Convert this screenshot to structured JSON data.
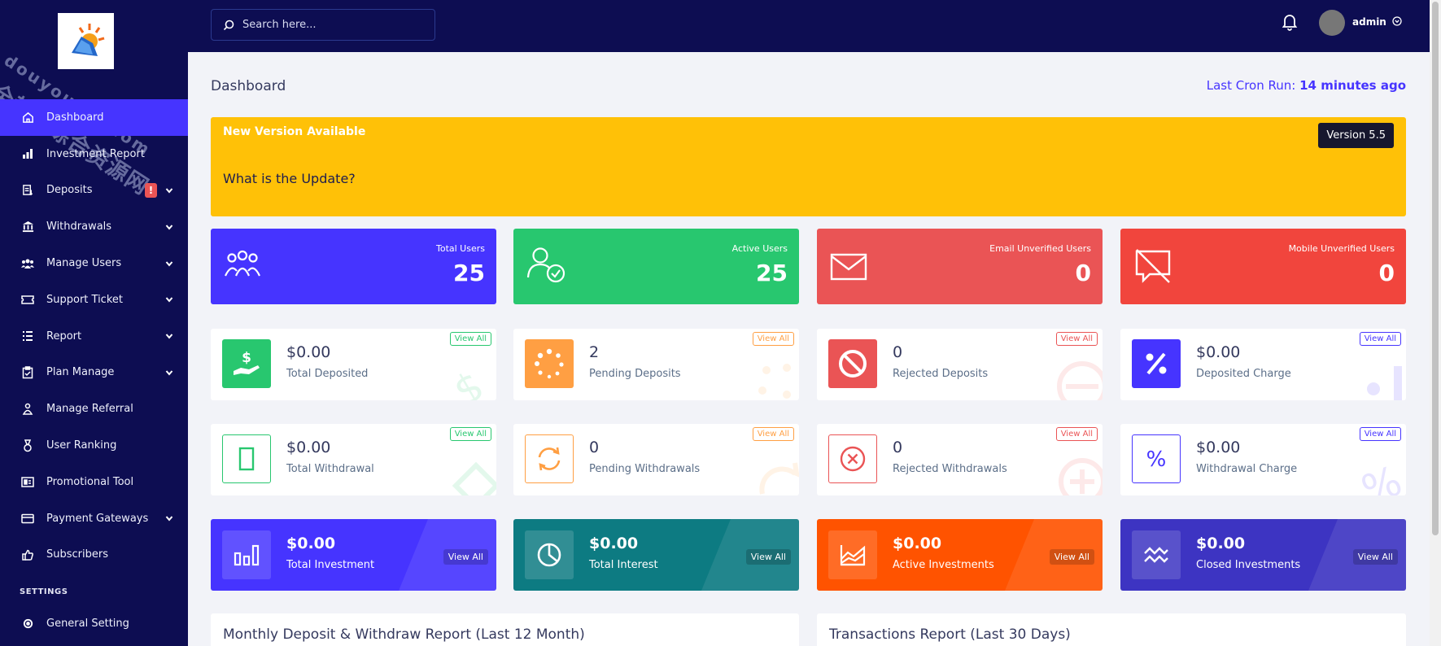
{
  "colors": {
    "sidebar": "#0d0d52",
    "accent": "#4634ff",
    "banner": "#ffc107",
    "success": "#28c76f",
    "danger": "#ea5455",
    "red": "#f1453d",
    "orange": "#ff9f43",
    "teal": "#0d7b82",
    "deep_orange": "#ff5300",
    "indigo": "#3d34c2"
  },
  "watermark": {
    "line1": "全都有综合资源网",
    "line2": "douyouvip.com"
  },
  "sidebar": {
    "items": [
      {
        "label": "Dashboard",
        "icon": "home-icon"
      },
      {
        "label": "Investment Report",
        "icon": "bar-chart-icon"
      },
      {
        "label": "Deposits",
        "icon": "deposit-icon",
        "badge": "!"
      },
      {
        "label": "Withdrawals",
        "icon": "bank-icon"
      },
      {
        "label": "Manage Users",
        "icon": "users-icon"
      },
      {
        "label": "Support Ticket",
        "icon": "ticket-icon"
      },
      {
        "label": "Report",
        "icon": "list-icon"
      },
      {
        "label": "Plan Manage",
        "icon": "clipboard-icon"
      },
      {
        "label": "Manage Referral",
        "icon": "referral-icon"
      },
      {
        "label": "User Ranking",
        "icon": "medal-icon"
      },
      {
        "label": "Promotional Tool",
        "icon": "promo-icon"
      },
      {
        "label": "Payment Gateways",
        "icon": "card-icon"
      },
      {
        "label": "Subscribers",
        "icon": "thumbs-up-icon"
      }
    ],
    "settings_heading": "SETTINGS",
    "general_setting": "General Setting"
  },
  "topbar": {
    "search_placeholder": "Search here...",
    "username": "admin"
  },
  "page": {
    "title": "Dashboard",
    "cron_label": "Last Cron Run:",
    "cron_value": "14 minutes ago"
  },
  "banner": {
    "heading": "New Version Available",
    "question": "What is the Update?",
    "version": "Version 5.5"
  },
  "stats": [
    {
      "label": "Total Users",
      "value": "25"
    },
    {
      "label": "Active Users",
      "value": "25"
    },
    {
      "label": "Email Unverified Users",
      "value": "0"
    },
    {
      "label": "Mobile Unverified Users",
      "value": "0"
    }
  ],
  "deposit_cards": [
    {
      "value": "$0.00",
      "label": "Total Deposited",
      "view": "View All"
    },
    {
      "value": "2",
      "label": "Pending Deposits",
      "view": "View All"
    },
    {
      "value": "0",
      "label": "Rejected Deposits",
      "view": "View All"
    },
    {
      "value": "$0.00",
      "label": "Deposited Charge",
      "view": "View All"
    }
  ],
  "withdraw_cards": [
    {
      "value": "$0.00",
      "label": "Total Withdrawal",
      "view": "View All"
    },
    {
      "value": "0",
      "label": "Pending Withdrawals",
      "view": "View All"
    },
    {
      "value": "0",
      "label": "Rejected Withdrawals",
      "view": "View All"
    },
    {
      "value": "$0.00",
      "label": "Withdrawal Charge",
      "view": "View All"
    }
  ],
  "invest_cards": [
    {
      "value": "$0.00",
      "label": "Total Investment",
      "view": "View All"
    },
    {
      "value": "$0.00",
      "label": "Total Interest",
      "view": "View All"
    },
    {
      "value": "$0.00",
      "label": "Active Investments",
      "view": "View All"
    },
    {
      "value": "$0.00",
      "label": "Closed Investments",
      "view": "View All"
    }
  ],
  "panels": {
    "left": "Monthly Deposit & Withdraw Report (Last 12 Month)",
    "right": "Transactions Report (Last 30 Days)"
  }
}
